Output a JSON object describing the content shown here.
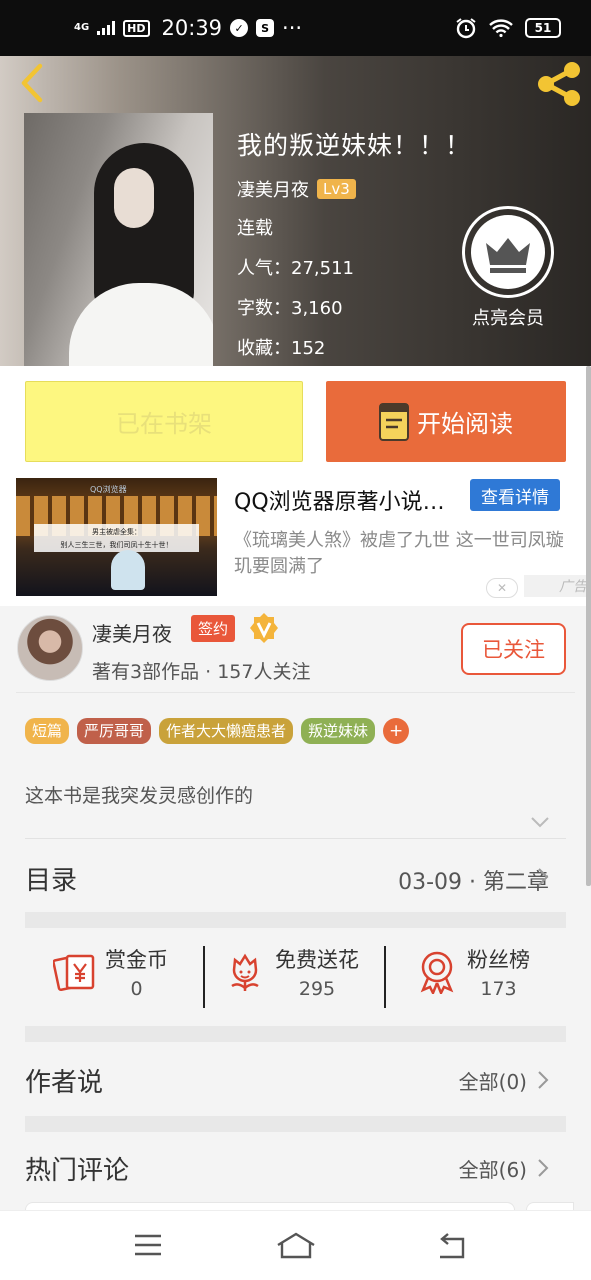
{
  "status_bar": {
    "network": "4G",
    "hd": "HD",
    "time": "20:39",
    "more": "···",
    "battery": "51"
  },
  "book": {
    "title": "我的叛逆妹妹！！！",
    "author": "凄美月夜",
    "level": "Lv3",
    "status": "连载",
    "popularity": "人气：27,511",
    "word_count": "字数：3,160",
    "favorites": "收藏：152"
  },
  "vip": {
    "label": "点亮会员"
  },
  "actions": {
    "shelf_label": "已在书架",
    "read_label": "开始阅读"
  },
  "ad": {
    "title": "QQ浏览器原著小说…",
    "button": "查看详情",
    "description": "《琉璃美人煞》被虐了九世 这一世司凤璇玑要圆满了",
    "mark": "广告",
    "image_logo": "QQ浏览器",
    "image_caption_line1": "男主被虐全集：",
    "image_caption_line2": "别人三生三世，我们司凤十生十世！"
  },
  "author_card": {
    "name": "凄美月夜",
    "signed": "签约",
    "stats": "著有3部作品 · 157人关注",
    "follow": "已关注"
  },
  "tags": [
    {
      "label": "短篇",
      "color": "#f0b44b"
    },
    {
      "label": "严厉哥哥",
      "color": "#c0604a"
    },
    {
      "label": "作者大大懒癌患者",
      "color": "#c9a23a"
    },
    {
      "label": "叛逆妹妹",
      "color": "#8fb054"
    }
  ],
  "tag_more": "+",
  "intro": "这本书是我突发灵感创作的",
  "toc": {
    "label": "目录",
    "latest": "03-09 · 第二章"
  },
  "stats": [
    {
      "label": "赏金币",
      "value": "0",
      "icon": "reward-coin-icon"
    },
    {
      "label": "免费送花",
      "value": "295",
      "icon": "flower-icon"
    },
    {
      "label": "粉丝榜",
      "value": "173",
      "icon": "medal-icon"
    }
  ],
  "author_says": {
    "label": "作者说",
    "count": "全部(0)"
  },
  "hot_comments": {
    "label": "热门评论",
    "count": "全部(6)"
  },
  "colors": {
    "accent": "#e96b3b",
    "shelf": "#fdf780",
    "ad_button": "#2f79d6",
    "signed": "#e9573a"
  }
}
